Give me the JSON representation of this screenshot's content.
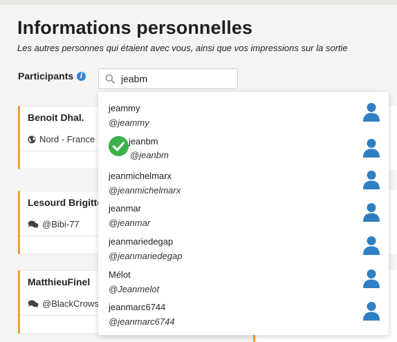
{
  "header": {
    "title": "Informations personnelles",
    "subtitle": "Les autres personnes qui étaient avec vous, ainsi que vos impressions sur la sortie"
  },
  "participants": {
    "label": "Participants",
    "info_icon": "i",
    "search_value": "jeabm"
  },
  "cards": [
    {
      "name": "Benoit Dhal.",
      "detail": "Nord - France",
      "detail_icon": "globe-icon"
    },
    {
      "name": "Lesourd Brigitte",
      "detail": "@Bibi-77",
      "detail_icon": "chat-icon"
    },
    {
      "name": "MatthieuFinel",
      "detail": "@BlackCrowsM",
      "detail_icon": "chat-icon"
    }
  ],
  "suggestions": [
    {
      "username": "jeammy",
      "handle": "@jeammy",
      "selected": false
    },
    {
      "username": "jeanbm",
      "handle": "@jeanbm",
      "selected": true
    },
    {
      "username": "jeanmichelmarx",
      "handle": "@jeanmichelmarx",
      "selected": false
    },
    {
      "username": "jeanmar",
      "handle": "@jeanmar",
      "selected": false
    },
    {
      "username": "jeanmariedegap",
      "handle": "@jeanmariedegap",
      "selected": false
    },
    {
      "username": "Mélot",
      "handle": "@Jeanmelot",
      "selected": false
    },
    {
      "username": "jeanmarc6744",
      "handle": "@jeanmarc6744",
      "selected": false
    }
  ],
  "colors": {
    "accent_orange": "#f39c3a",
    "user_icon_blue": "#2f7fc1",
    "check_green": "#3cb04a",
    "info_blue": "#2f86d6"
  }
}
